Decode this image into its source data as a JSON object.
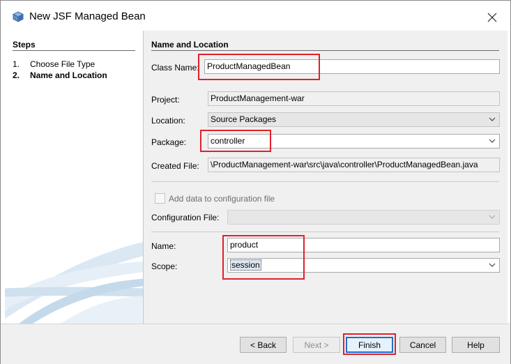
{
  "window": {
    "title": "New JSF Managed Bean",
    "app_icon": "cube-icon",
    "close_glyph": "✕"
  },
  "steps": {
    "title": "Steps",
    "items": [
      {
        "num": "1.",
        "label": "Choose File Type",
        "active": false
      },
      {
        "num": "2.",
        "label": "Name and Location",
        "active": true
      }
    ]
  },
  "form": {
    "section_title": "Name and Location",
    "class_name_label": "Class Name:",
    "class_name_value": "ProductManagedBean",
    "project_label": "Project:",
    "project_value": "ProductManagement-war",
    "location_label": "Location:",
    "location_value": "Source Packages",
    "package_label": "Package:",
    "package_value": "controller",
    "created_file_label": "Created File:",
    "created_file_value": "\\ProductManagement-war\\src\\java\\controller\\ProductManagedBean.java",
    "add_config_label": "Add data to configuration file",
    "add_config_checked": false,
    "config_file_label": "Configuration File:",
    "config_file_value": "",
    "name_label": "Name:",
    "name_value": "product",
    "scope_label": "Scope:",
    "scope_value": "session"
  },
  "buttons": {
    "back": "< Back",
    "next": "Next >",
    "finish": "Finish",
    "cancel": "Cancel",
    "help": "Help"
  },
  "colors": {
    "highlight": "#e1202b",
    "default_button_border": "#1f6fc9"
  }
}
